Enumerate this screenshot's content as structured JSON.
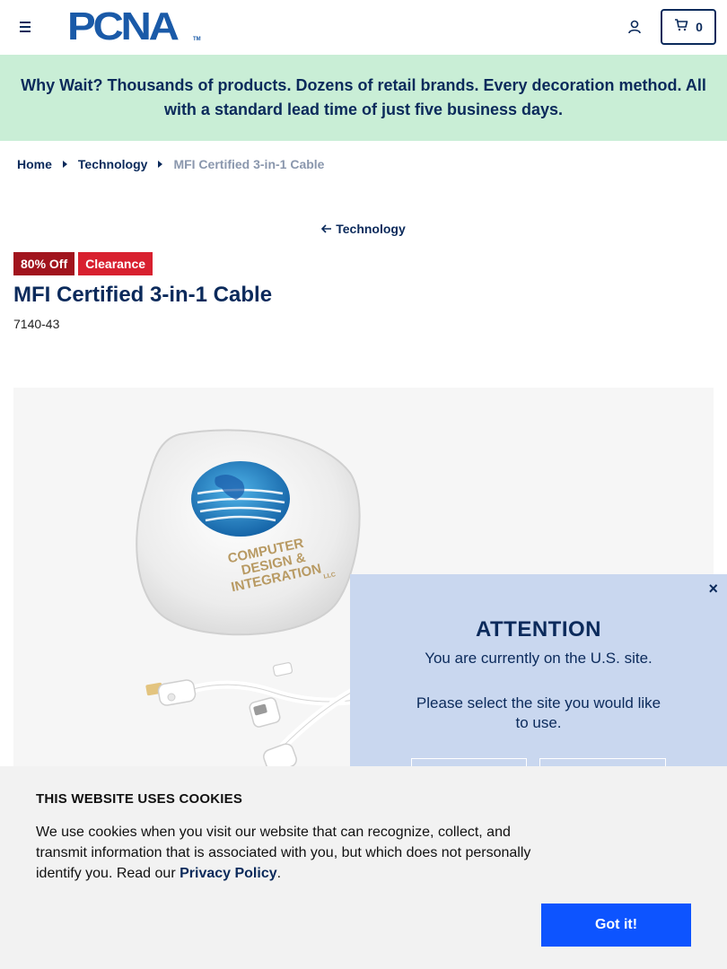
{
  "header": {
    "logo_text": "PCNA",
    "logo_tm": "TM",
    "cart_count": "0"
  },
  "banner": {
    "text": "Why Wait? Thousands of products. Dozens of retail brands. Every decoration method. All with a standard lead time of just five business days."
  },
  "breadcrumb": {
    "items": [
      "Home",
      "Technology"
    ],
    "current": "MFI Certified 3-in-1 Cable"
  },
  "back_link": "Technology",
  "product": {
    "badges": [
      "80% Off",
      "Clearance"
    ],
    "title": "MFI Certified 3-in-1 Cable",
    "sku": "7140-43",
    "case_print": [
      "COMPUTER",
      "DESIGN &",
      "INTEGRATION",
      "LLC"
    ]
  },
  "attention": {
    "close": "×",
    "title": "ATTENTION",
    "line1": "You are currently on the U.S. site.",
    "line2": "Please select the site you would like to use."
  },
  "cookie": {
    "title": "THIS WEBSITE USES COOKIES",
    "text": "We use cookies when you visit our website that can recognize, collect, and transmit information that is associated with you, but which does not personally identify you. Read our ",
    "link": "Privacy Policy",
    "end": ".",
    "button": "Got it!"
  },
  "colors": {
    "navy": "#0b2a5b",
    "brand_blue": "#1a5aa8",
    "banner_green": "#c9eed6",
    "badge_dark_red": "#a1141d",
    "badge_red": "#d8202f",
    "popup_blue": "#c9d7ef",
    "cookie_button": "#0d54ff"
  },
  "icons": [
    "menu-icon",
    "user-icon",
    "cart-icon",
    "caret-right-icon",
    "arrow-left-icon",
    "close-icon"
  ]
}
